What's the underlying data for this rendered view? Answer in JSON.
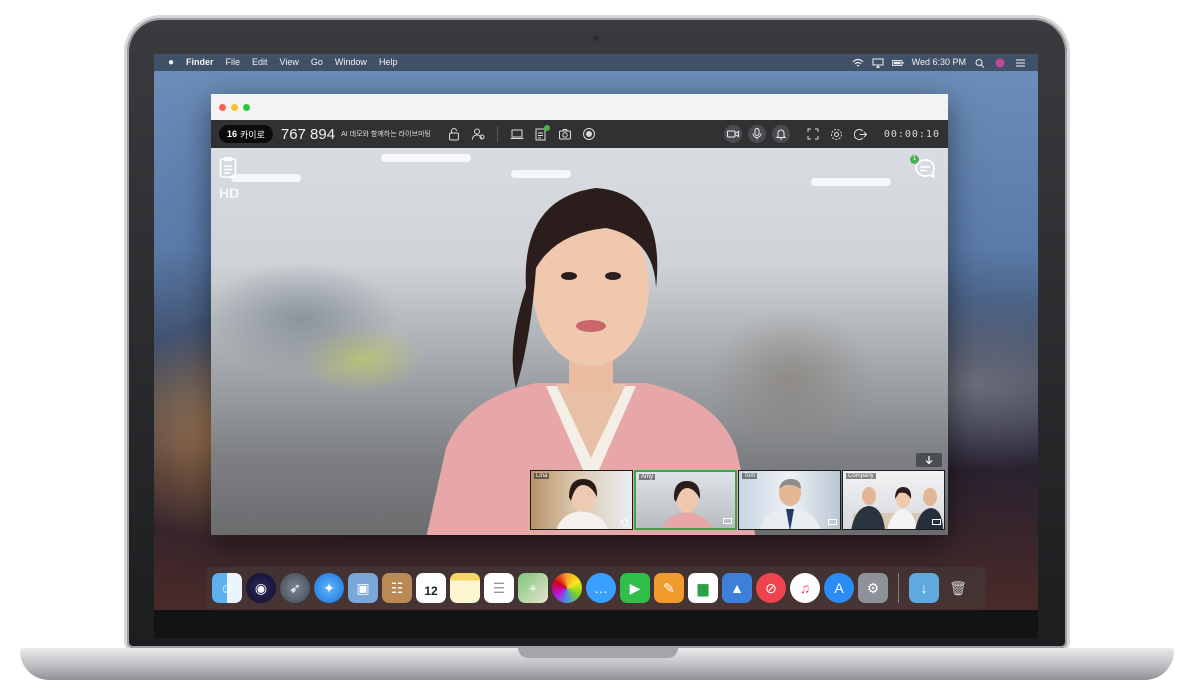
{
  "menubar": {
    "items": [
      "Finder",
      "File",
      "Edit",
      "View",
      "Go",
      "Window",
      "Help"
    ],
    "clock": "Wed 6:30 PM"
  },
  "toolbar": {
    "participant_count": "16",
    "participant_label": "카이로",
    "room_id": "767 894",
    "room_title": "AI 데모와 함께하는 라이브미팅",
    "timer": "00:00:10"
  },
  "stage": {
    "quality_label": "HD",
    "chat_unread": "1"
  },
  "participants": [
    {
      "name": "Lina",
      "active": false
    },
    {
      "name": "Amy",
      "active": true
    },
    {
      "name": "Tom",
      "active": false
    },
    {
      "name": "Company",
      "active": false
    }
  ],
  "dock": {
    "calendar_day": "12",
    "apps": [
      "finder-icon",
      "siri-icon",
      "launchpad-icon",
      "safari-icon",
      "preview-icon",
      "contacts-icon",
      "calendar-icon",
      "notes-icon",
      "reminders-icon",
      "maps-icon",
      "photos-icon",
      "messages-icon",
      "facetime-icon",
      "pages-icon",
      "numbers-icon",
      "keynote-icon",
      "news-icon",
      "music-icon",
      "app-store-icon",
      "system-preferences-icon",
      "downloads-folder-icon",
      "trash-icon"
    ]
  },
  "colors": {
    "active_speaker_border": "#3fa34d",
    "toolbar_bg": "#303133",
    "badge_bg": "#0b0b0b"
  }
}
